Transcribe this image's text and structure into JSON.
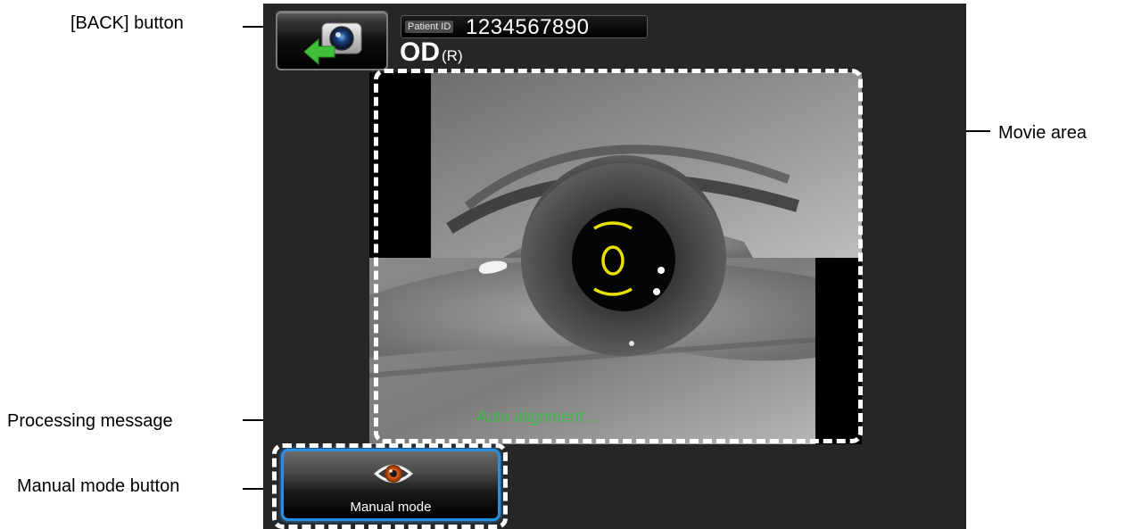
{
  "callouts": {
    "back": "[BACK] button",
    "movie": "Movie area",
    "processing": "Processing message",
    "manual": "Manual mode button"
  },
  "header": {
    "patient_id_label": "Patient ID",
    "patient_id_value": "1234567890",
    "eye": "OD",
    "eye_side": "(R)"
  },
  "movie": {
    "processing_message": "Auto alignment..."
  },
  "manual_mode": {
    "label": "Manual mode"
  },
  "colors": {
    "screen_background": "#262626",
    "processing_text": "#3eb94a",
    "manual_button_border": "#2a8fe0",
    "alignment_marker": "#e8e000"
  },
  "icons": {
    "back": "camera-back-arrow-icon",
    "manual": "eye-icon"
  }
}
